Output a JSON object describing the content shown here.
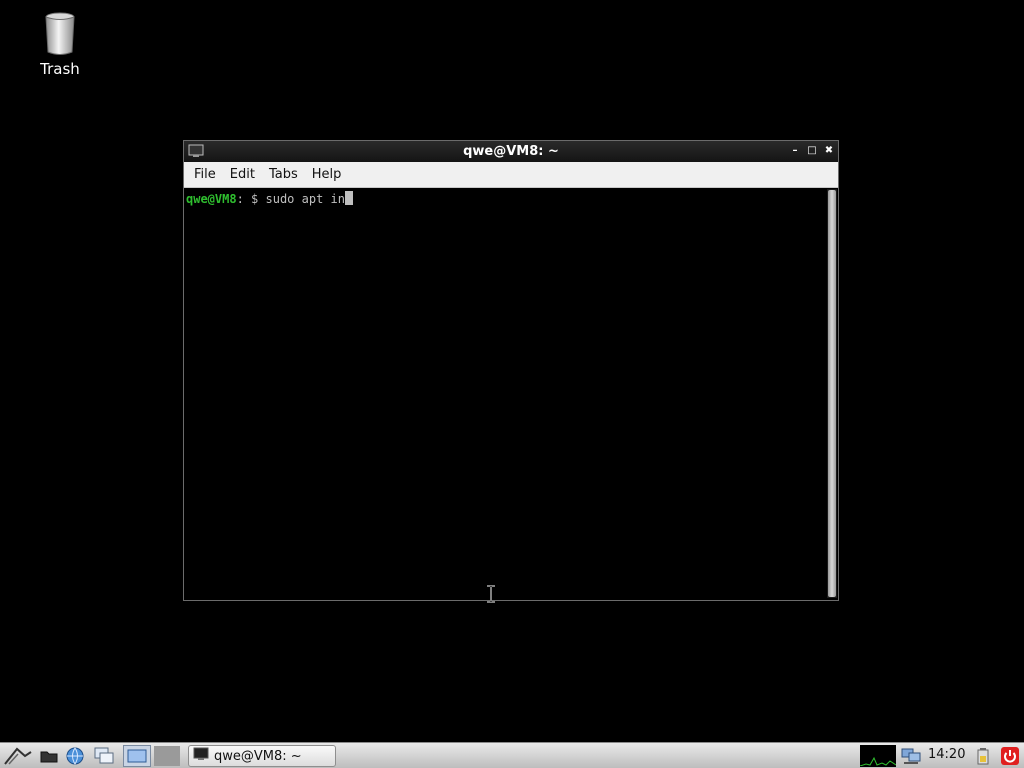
{
  "desktop": {
    "icons": [
      {
        "label": "Trash",
        "icon": "trash-icon"
      }
    ]
  },
  "window": {
    "title": "qwe@VM8: ~",
    "menu": [
      "File",
      "Edit",
      "Tabs",
      "Help"
    ],
    "controls": {
      "minimize": "minimize-icon",
      "maximize": "maximize-icon",
      "close": "close-icon"
    }
  },
  "terminal": {
    "prompt_user": "qwe@VM8",
    "prompt_sep": ":",
    "prompt_path": " $ ",
    "command": "sudo apt in"
  },
  "taskbar": {
    "launchers": [
      "start-menu-icon",
      "file-manager-icon",
      "web-browser-icon",
      "show-desktop-icon",
      "workspace-icon"
    ],
    "task_label": "qwe@VM8: ~",
    "clock": "14:20",
    "tray": [
      "cpu-monitor-icon",
      "network-icon",
      "battery-icon",
      "power-icon"
    ]
  },
  "colors": {
    "desktop_bg": "#000000",
    "prompt_user": "#2fbf2f",
    "power": "#e02020"
  }
}
